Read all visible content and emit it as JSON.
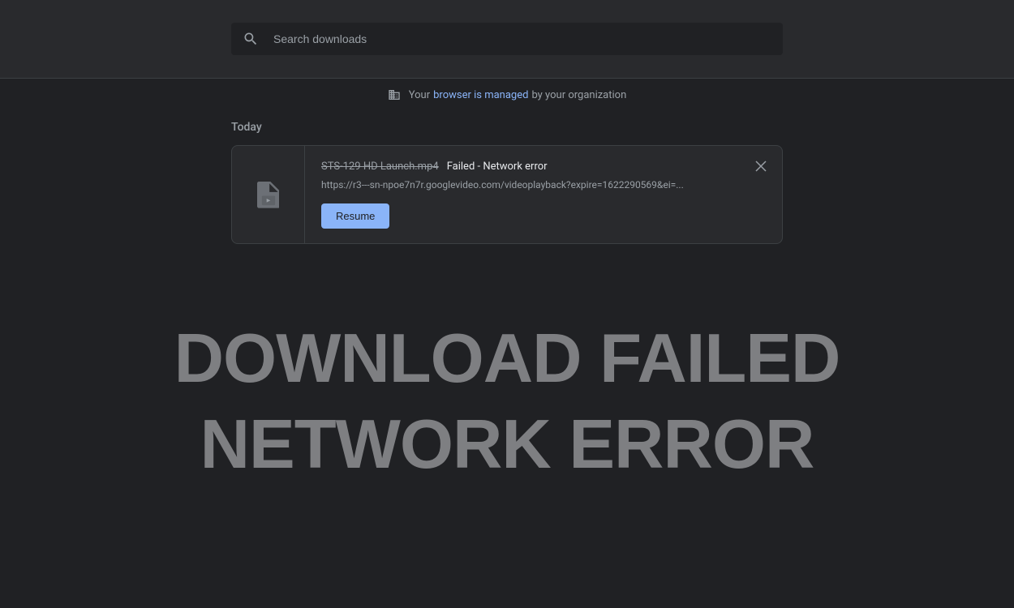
{
  "search": {
    "placeholder": "Search downloads"
  },
  "managed": {
    "prefix": "Your",
    "link": "browser is managed",
    "suffix": "by your organization"
  },
  "section": {
    "title": "Today"
  },
  "download": {
    "filename": "STS-129 HD Launch.mp4",
    "status": "Failed - Network error",
    "url": "https://r3---sn-npoe7n7r.googlevideo.com/videoplayback?expire=1622290569&ei=...",
    "resume_label": "Resume"
  },
  "overlay": {
    "line1": "DOWNLOAD FAILED",
    "line2": "NETWORK ERROR"
  }
}
